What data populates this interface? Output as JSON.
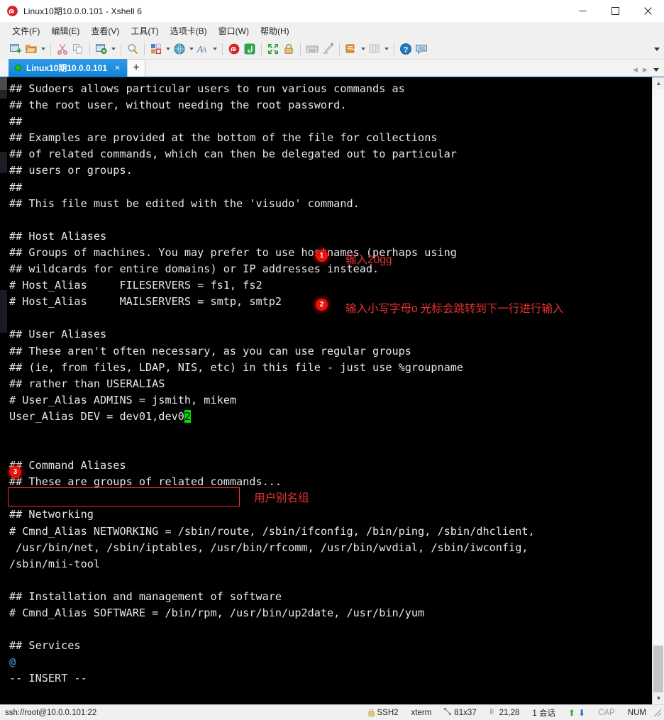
{
  "window": {
    "title": "Linux10期10.0.0.101 - Xshell 6",
    "app_icon": "xshell-logo-icon",
    "buttons": {
      "minimize": "minimize-icon",
      "maximize": "maximize-icon",
      "close": "close-icon"
    }
  },
  "menubar": {
    "items": [
      {
        "label": "文件(F)",
        "name": "menu-file"
      },
      {
        "label": "编辑(E)",
        "name": "menu-edit"
      },
      {
        "label": "查看(V)",
        "name": "menu-view"
      },
      {
        "label": "工具(T)",
        "name": "menu-tools"
      },
      {
        "label": "选项卡(B)",
        "name": "menu-tab"
      },
      {
        "label": "窗口(W)",
        "name": "menu-window"
      },
      {
        "label": "帮助(H)",
        "name": "menu-help"
      }
    ]
  },
  "toolbar": {
    "overflow": "toolbar-overflow-chevron"
  },
  "tabs": {
    "active": {
      "label": "Linux10期10.0.0.101",
      "close": "×"
    },
    "new_tab": "+",
    "nav_prev": "◀",
    "nav_next": "▶"
  },
  "terminal": {
    "lines": [
      "## Sudoers allows particular users to run various commands as",
      "## the root user, without needing the root password.",
      "##",
      "## Examples are provided at the bottom of the file for collections",
      "## of related commands, which can then be delegated out to particular",
      "## users or groups.",
      "##",
      "## This file must be edited with the 'visudo' command.",
      "",
      "## Host Aliases",
      "## Groups of machines. You may prefer to use hostnames (perhaps using",
      "## wildcards for entire domains) or IP addresses instead.",
      "# Host_Alias     FILESERVERS = fs1, fs2",
      "# Host_Alias     MAILSERVERS = smtp, smtp2",
      "",
      "## User Aliases",
      "## These aren't often necessary, as you can use regular groups",
      "## (ie, from files, LDAP, NIS, etc) in this file - just use %groupname",
      "## rather than USERALIAS",
      "# User_Alias ADMINS = jsmith, mikem"
    ],
    "edited_line": {
      "prefix": "User_Alias DEV = dev01,dev0",
      "cursor_char": "2"
    },
    "lines_after": [
      "",
      "",
      "## Command Aliases",
      "## These are groups of related commands...",
      "",
      "## Networking",
      "# Cmnd_Alias NETWORKING = /sbin/route, /sbin/ifconfig, /bin/ping, /sbin/dhclient,",
      " /usr/bin/net, /sbin/iptables, /usr/bin/rfcomm, /usr/bin/wvdial, /sbin/iwconfig,",
      "/sbin/mii-tool",
      "",
      "## Installation and management of software",
      "# Cmnd_Alias SOFTWARE = /bin/rpm, /usr/bin/up2date, /usr/bin/yum",
      "",
      "## Services"
    ],
    "tilde_line": "@",
    "mode_line": "-- INSERT --",
    "cursor_color": "#00e000",
    "blue_color": "#4a9ce0"
  },
  "annotations": [
    {
      "badge": "1",
      "text": "输入20gg",
      "name": "annotation-step-1"
    },
    {
      "badge": "2",
      "text": "输入小写字母o  光标会跳转到下一行进行输入",
      "name": "annotation-step-2"
    },
    {
      "badge": "3",
      "text": "用户别名组",
      "name": "annotation-step-3"
    }
  ],
  "annotation_color": "#e8332e",
  "statusbar": {
    "connection": "ssh://root@10.0.0.101:22",
    "protocol": "SSH2",
    "term_type": "xterm",
    "size": "81x37",
    "cursor_pos": "21,28",
    "sessions": "1 会话",
    "cap": "CAP",
    "num": "NUM"
  }
}
